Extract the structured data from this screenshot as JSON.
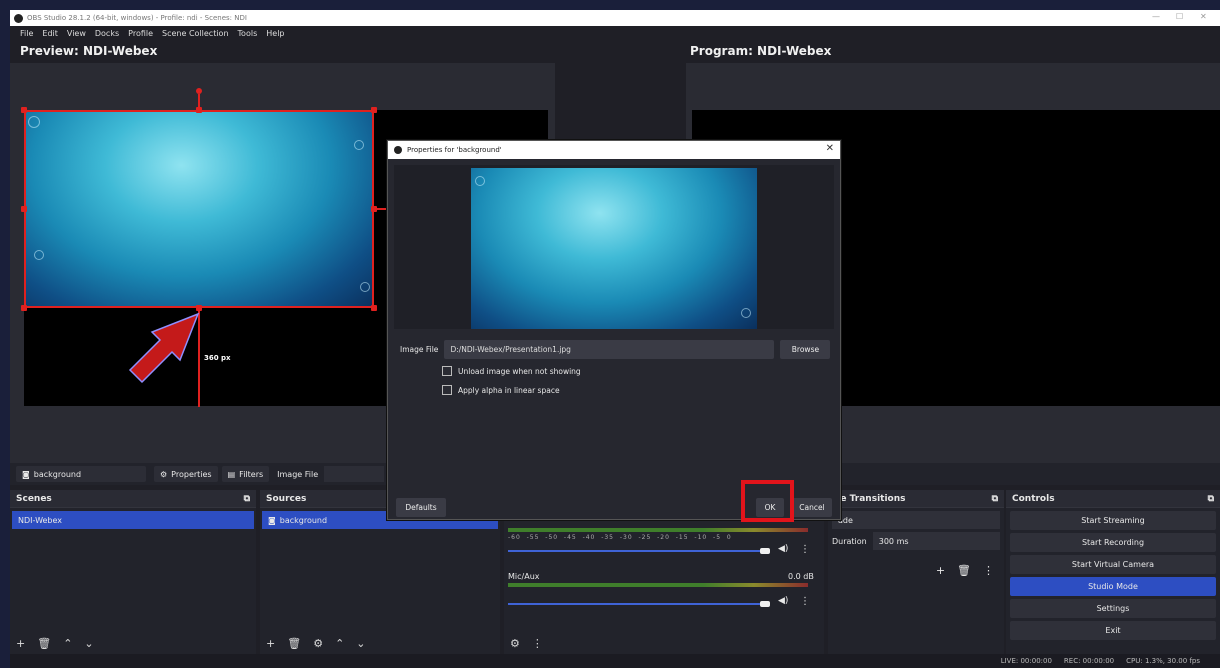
{
  "window": {
    "title": "OBS Studio 28.1.2 (64-bit, windows) - Profile: ndi - Scenes: NDI",
    "controls": [
      "—",
      "☐",
      "✕"
    ]
  },
  "menu": [
    "File",
    "Edit",
    "View",
    "Docks",
    "Profile",
    "Scene Collection",
    "Tools",
    "Help"
  ],
  "preview": {
    "title": "Preview: NDI-Webex",
    "dimension_label": "360 px"
  },
  "program": {
    "title": "Program: NDI-Webex"
  },
  "context_bar": {
    "source": "background",
    "properties_label": "Properties",
    "filters_label": "Filters",
    "image_file_label": "Image File"
  },
  "scenes": {
    "title": "Scenes",
    "items": [
      "NDI-Webex"
    ]
  },
  "sources": {
    "title": "Sources",
    "items": [
      "background"
    ]
  },
  "mixer": {
    "channel2_name": "Mic/Aux",
    "channel2_db": "0.0 dB",
    "scale": [
      "-60",
      "-55",
      "-50",
      "-45",
      "-40",
      "-35",
      "-30",
      "-25",
      "-20",
      "-15",
      "-10",
      "-5",
      "0"
    ]
  },
  "transitions": {
    "title": "Scene Transitions",
    "title_visible": "ne Transitions",
    "type": "Fade",
    "type_visible": "ade",
    "duration_label": "Duration",
    "duration_value": "300 ms"
  },
  "controls": {
    "title": "Controls",
    "buttons": [
      "Start Streaming",
      "Start Recording",
      "Start Virtual Camera",
      "Studio Mode",
      "Settings",
      "Exit"
    ]
  },
  "status": {
    "live": "LIVE: 00:00:00",
    "rec": "REC: 00:00:00",
    "cpu": "CPU: 1.3%, 30.00 fps"
  },
  "dialog": {
    "title": "Properties for 'background'",
    "image_file_label": "Image File",
    "image_file_value": "D:/NDI-Webex/Presentation1.jpg",
    "browse_label": "Browse",
    "checkbox1": "Unload image when not showing",
    "checkbox2": "Apply alpha in linear space",
    "defaults_label": "Defaults",
    "ok_label": "OK",
    "cancel_label": "Cancel"
  },
  "colors": {
    "accent": "#2d4ec2",
    "highlight": "#e2141b",
    "arrow": "#c41a1a"
  }
}
